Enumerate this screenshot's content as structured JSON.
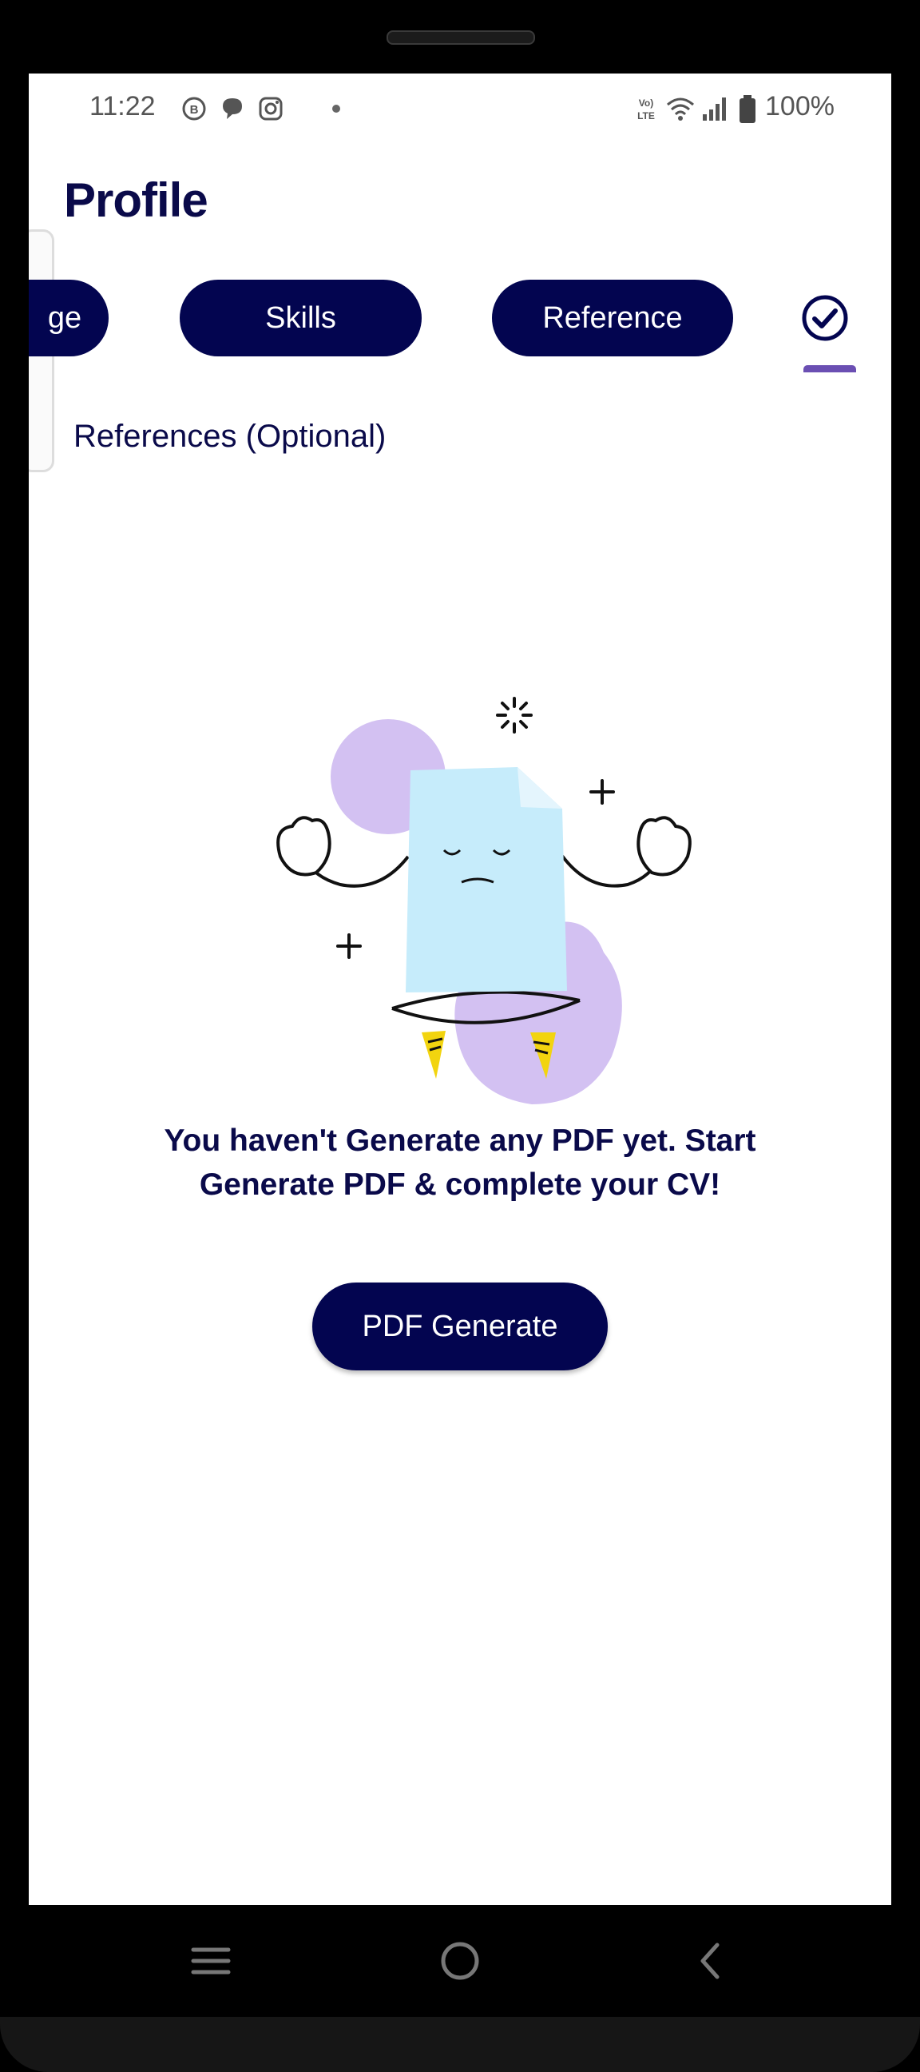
{
  "status_bar": {
    "time": "11:22",
    "battery": "100%",
    "icons": [
      "business-chat-icon",
      "message-icon",
      "instagram-icon",
      "dot-icon",
      "volte-icon",
      "wifi-icon",
      "signal-icon",
      "battery-icon"
    ]
  },
  "header": {
    "title": "Profile"
  },
  "tabs": [
    {
      "label": "ge"
    },
    {
      "label": "Skills"
    },
    {
      "label": "Reference"
    }
  ],
  "active_tab_icon": "check-circle-icon",
  "section": {
    "label": "References (Optional)"
  },
  "empty_state": {
    "line1": "You haven't Generate any PDF yet. Start",
    "line2": "Generate PDF & complete your CV!"
  },
  "actions": {
    "pdf_generate": "PDF Generate"
  },
  "colors": {
    "primary": "#030550",
    "text": "#0a0a4a",
    "accent": "#6b4fb3",
    "blob": "#d3c1f2",
    "doc": "#c6ecfb",
    "feet": "#f2d40f"
  }
}
